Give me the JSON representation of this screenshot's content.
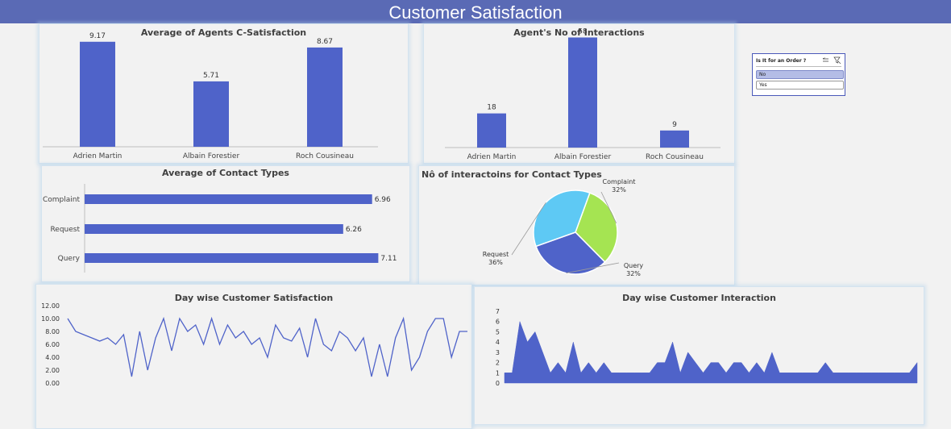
{
  "header": {
    "title": "Customer Satisfaction"
  },
  "slicer": {
    "title": "Is It for an Order ?",
    "options": [
      "No",
      "Yes"
    ],
    "selected": "No",
    "icons": [
      "multi-select-icon",
      "clear-filter-icon"
    ]
  },
  "colors": {
    "bar": "#4f63c9",
    "header": "#5a6ab5",
    "pie_complaint": "#a5e452",
    "pie_query": "#4f63c9",
    "pie_request": "#5ec9f4"
  },
  "chart_data": [
    {
      "id": "agent_csat",
      "type": "bar",
      "title": "Average of Agents C-Satisfaction",
      "categories": [
        "Adrien Martin",
        "Albain Forestier",
        "Roch Cousineau"
      ],
      "values": [
        9.17,
        5.71,
        8.67
      ],
      "labels": [
        "9.17",
        "5.71",
        "8.67"
      ],
      "ylim": [
        0,
        10
      ]
    },
    {
      "id": "agent_interactions",
      "type": "bar",
      "title": "Agent's No of Interactions",
      "categories": [
        "Adrien Martin",
        "Albain Forestier",
        "Roch Cousineau"
      ],
      "values": [
        18,
        58,
        9
      ],
      "labels": [
        "18",
        "58",
        "9"
      ],
      "ylim": [
        0,
        65
      ]
    },
    {
      "id": "contact_types",
      "type": "bar",
      "orientation": "horizontal",
      "title": "Average of Contact Types",
      "categories": [
        "Complaint",
        "Request",
        "Query"
      ],
      "values": [
        6.96,
        6.26,
        7.11
      ],
      "labels": [
        "6.96",
        "6.26",
        "7.11"
      ],
      "xlim": [
        0,
        7.2
      ]
    },
    {
      "id": "contact_pie",
      "type": "pie",
      "title": "Nô of interactoins for Contact Types",
      "categories": [
        "Complaint",
        "Query",
        "Request"
      ],
      "values": [
        32,
        32,
        36
      ],
      "labels": [
        "32%",
        "32%",
        "36%"
      ]
    },
    {
      "id": "day_csat",
      "type": "line",
      "title": "Day wise Customer Satisfaction",
      "yticks": [
        "12.00",
        "10.00",
        "8.00",
        "6.00",
        "4.00",
        "2.00",
        "0.00"
      ],
      "ylim": [
        0,
        12
      ],
      "values": [
        10,
        8,
        7.5,
        7,
        6.5,
        7,
        6,
        7.5,
        1,
        8,
        2,
        7,
        10,
        5,
        10,
        8,
        9,
        6,
        10,
        6,
        9,
        7,
        8,
        6,
        7,
        4,
        9,
        7,
        6.5,
        8.5,
        4,
        10,
        6,
        5,
        8,
        7,
        5,
        7,
        1,
        6,
        1,
        7,
        10,
        2,
        4,
        8,
        10,
        10,
        4,
        8,
        8
      ]
    },
    {
      "id": "day_interactions",
      "type": "area",
      "title": "Day wise Customer Interaction",
      "yticks": [
        "7",
        "6",
        "5",
        "4",
        "3",
        "2",
        "1",
        "0"
      ],
      "ylim": [
        0,
        7
      ],
      "values": [
        1,
        1,
        6,
        4,
        5,
        3,
        1,
        2,
        1,
        4,
        1,
        2,
        1,
        2,
        1,
        1,
        1,
        1,
        1,
        1,
        2,
        2,
        4,
        1,
        3,
        2,
        1,
        2,
        2,
        1,
        2,
        2,
        1,
        2,
        1,
        3,
        1,
        1,
        1,
        1,
        1,
        1,
        2,
        1,
        1,
        1,
        1,
        1,
        1,
        1,
        1,
        1,
        1,
        1,
        2
      ]
    }
  ]
}
